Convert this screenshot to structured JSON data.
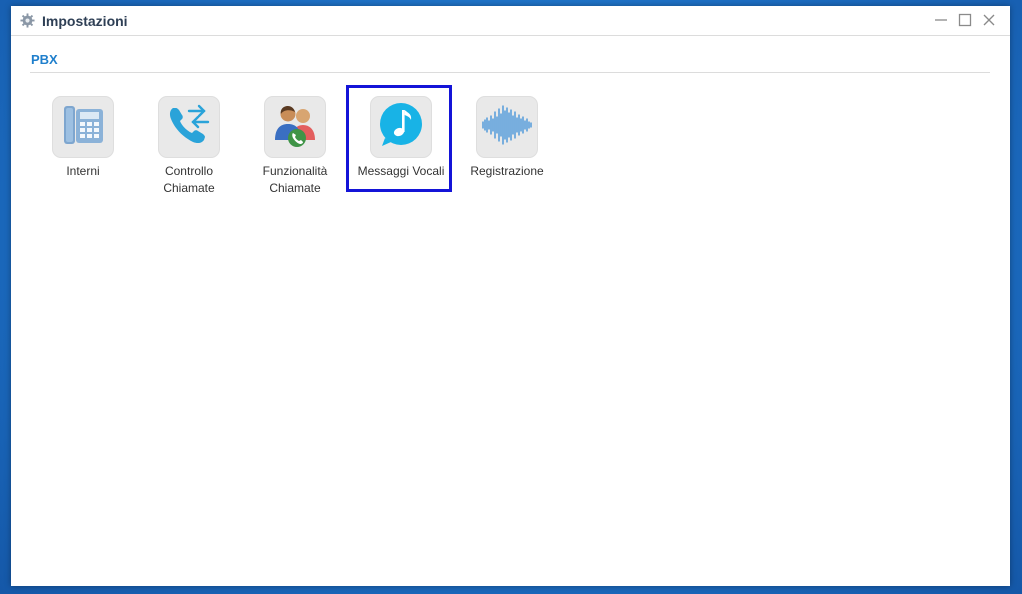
{
  "window": {
    "title": "Impostazioni",
    "title_icon": "gear-icon",
    "controls": [
      "minimize-icon",
      "maximize-icon",
      "close-icon"
    ]
  },
  "section": {
    "title": "PBX"
  },
  "apps": [
    {
      "label_line1": "Interni",
      "label_line2": "",
      "icon": "desk-phone-icon"
    },
    {
      "label_line1": "Controllo",
      "label_line2": "Chiamate",
      "icon": "call-transfer-icon"
    },
    {
      "label_line1": "Funzionalità",
      "label_line2": "Chiamate",
      "icon": "users-phone-icon"
    },
    {
      "label_line1": "Messaggi Vocali",
      "label_line2": "",
      "icon": "music-note-icon",
      "selected": true
    },
    {
      "label_line1": "Registrazione",
      "label_line2": "",
      "icon": "sound-wave-icon"
    }
  ],
  "colors": {
    "accent": "#1f7fcc",
    "selection_border": "#1414d8",
    "background": "#1d6fc4"
  }
}
